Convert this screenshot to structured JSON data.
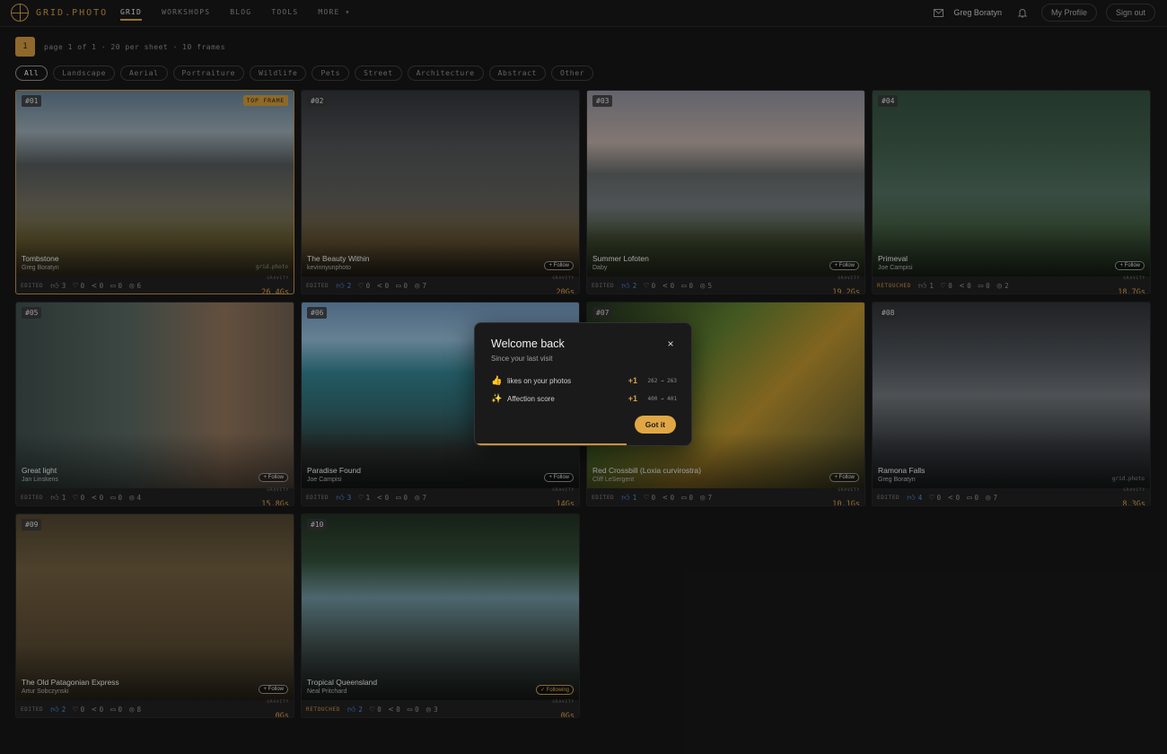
{
  "header": {
    "logo_text": "GRID.PHOTO",
    "nav": [
      {
        "label": "GRID",
        "active": true
      },
      {
        "label": "WORKSHOPS",
        "active": false
      },
      {
        "label": "BLOG",
        "active": false
      },
      {
        "label": "TOOLS",
        "active": false
      },
      {
        "label": "MORE ▾",
        "active": false
      }
    ],
    "user_name": "Greg Boratyn",
    "profile_label": "My Profile",
    "signout_label": "Sign out",
    "mail_icon": "mail-icon",
    "bell_icon": "bell-icon"
  },
  "pager": {
    "page": "1",
    "text": "page 1 of 1 · 20 per sheet · 10 frames"
  },
  "filters": [
    "All",
    "Landscape",
    "Aerial",
    "Portraiture",
    "Wildlife",
    "Pets",
    "Street",
    "Architecture",
    "Abstract",
    "Other"
  ],
  "filter_active": "All",
  "gravity_label": "GRAVITY",
  "cards": [
    {
      "num": "#01",
      "title": "Tombstone",
      "author": "Greg Boratyn",
      "badge": "TOP FRAME",
      "edit": "EDITED",
      "likes": "3",
      "liked": false,
      "hearts": "0",
      "shares": "0",
      "comments": "0",
      "views": "6",
      "gravity": "26.4Gs",
      "follow": "",
      "watermark": "grid.photo"
    },
    {
      "num": "#02",
      "title": "The Beauty Within",
      "author": "kevinnyunphoto",
      "badge": "",
      "edit": "EDITED",
      "likes": "2",
      "liked": true,
      "hearts": "0",
      "shares": "0",
      "comments": "0",
      "views": "7",
      "gravity": "20Gs",
      "follow": "+ Follow",
      "watermark": ""
    },
    {
      "num": "#03",
      "title": "Summer Lofoten",
      "author": "Daby",
      "badge": "",
      "edit": "EDITED",
      "likes": "2",
      "liked": true,
      "hearts": "0",
      "shares": "0",
      "comments": "0",
      "views": "5",
      "gravity": "19.2Gs",
      "follow": "+ Follow",
      "watermark": ""
    },
    {
      "num": "#04",
      "title": "Primeval",
      "author": "Joe Campisi",
      "badge": "",
      "edit": "RETOUCHED",
      "likes": "1",
      "liked": false,
      "hearts": "0",
      "shares": "0",
      "comments": "0",
      "views": "2",
      "gravity": "18.7Gs",
      "follow": "+ Follow",
      "watermark": ""
    },
    {
      "num": "#05",
      "title": "Great light",
      "author": "Jan Linskens",
      "badge": "",
      "edit": "EDITED",
      "likes": "1",
      "liked": false,
      "hearts": "0",
      "shares": "0",
      "comments": "0",
      "views": "4",
      "gravity": "15.8Gs",
      "follow": "+ Follow",
      "watermark": ""
    },
    {
      "num": "#06",
      "title": "Paradise Found",
      "author": "Joe Campisi",
      "badge": "",
      "edit": "EDITED",
      "likes": "3",
      "liked": true,
      "hearts": "1",
      "shares": "0",
      "comments": "0",
      "views": "7",
      "gravity": "14Gs",
      "follow": "+ Follow",
      "watermark": ""
    },
    {
      "num": "#07",
      "title": "Red Crossbill (Loxia curvirostra)",
      "author": "Cliff LeSergent",
      "badge": "",
      "edit": "EDITED",
      "likes": "1",
      "liked": true,
      "hearts": "0",
      "shares": "0",
      "comments": "0",
      "views": "7",
      "gravity": "10.1Gs",
      "follow": "+ Follow",
      "watermark": ""
    },
    {
      "num": "#08",
      "title": "Ramona Falls",
      "author": "Greg Boratyn",
      "badge": "",
      "edit": "EDITED",
      "likes": "4",
      "liked": true,
      "hearts": "0",
      "shares": "0",
      "comments": "0",
      "views": "7",
      "gravity": "8.3Gs",
      "follow": "",
      "watermark": "grid.photo"
    },
    {
      "num": "#09",
      "title": "The Old Patagonian Express",
      "author": "Artur Sobczynski",
      "badge": "",
      "edit": "EDITED",
      "likes": "2",
      "liked": true,
      "hearts": "0",
      "shares": "0",
      "comments": "0",
      "views": "8",
      "gravity": "0Gs",
      "follow": "+ Follow",
      "watermark": ""
    },
    {
      "num": "#10",
      "title": "Tropical Queensland",
      "author": "Neal Pritchard",
      "badge": "",
      "edit": "RETOUCHED",
      "likes": "2",
      "liked": true,
      "hearts": "0",
      "shares": "0",
      "comments": "0",
      "views": "3",
      "gravity": "0Gs",
      "follow": "✓ Following",
      "following": true,
      "watermark": ""
    }
  ],
  "modal": {
    "title": "Welcome back",
    "subtitle": "Since your last visit",
    "rows": [
      {
        "icon": "thumbs-up-icon",
        "label": "likes on your photos",
        "delta": "+1",
        "range": "262 → 263"
      },
      {
        "icon": "sparkle-icon",
        "label": "Affection score",
        "delta": "+1",
        "range": "400 → 401"
      }
    ],
    "button": "Got it",
    "close_label": "×",
    "progress": 0.7
  }
}
